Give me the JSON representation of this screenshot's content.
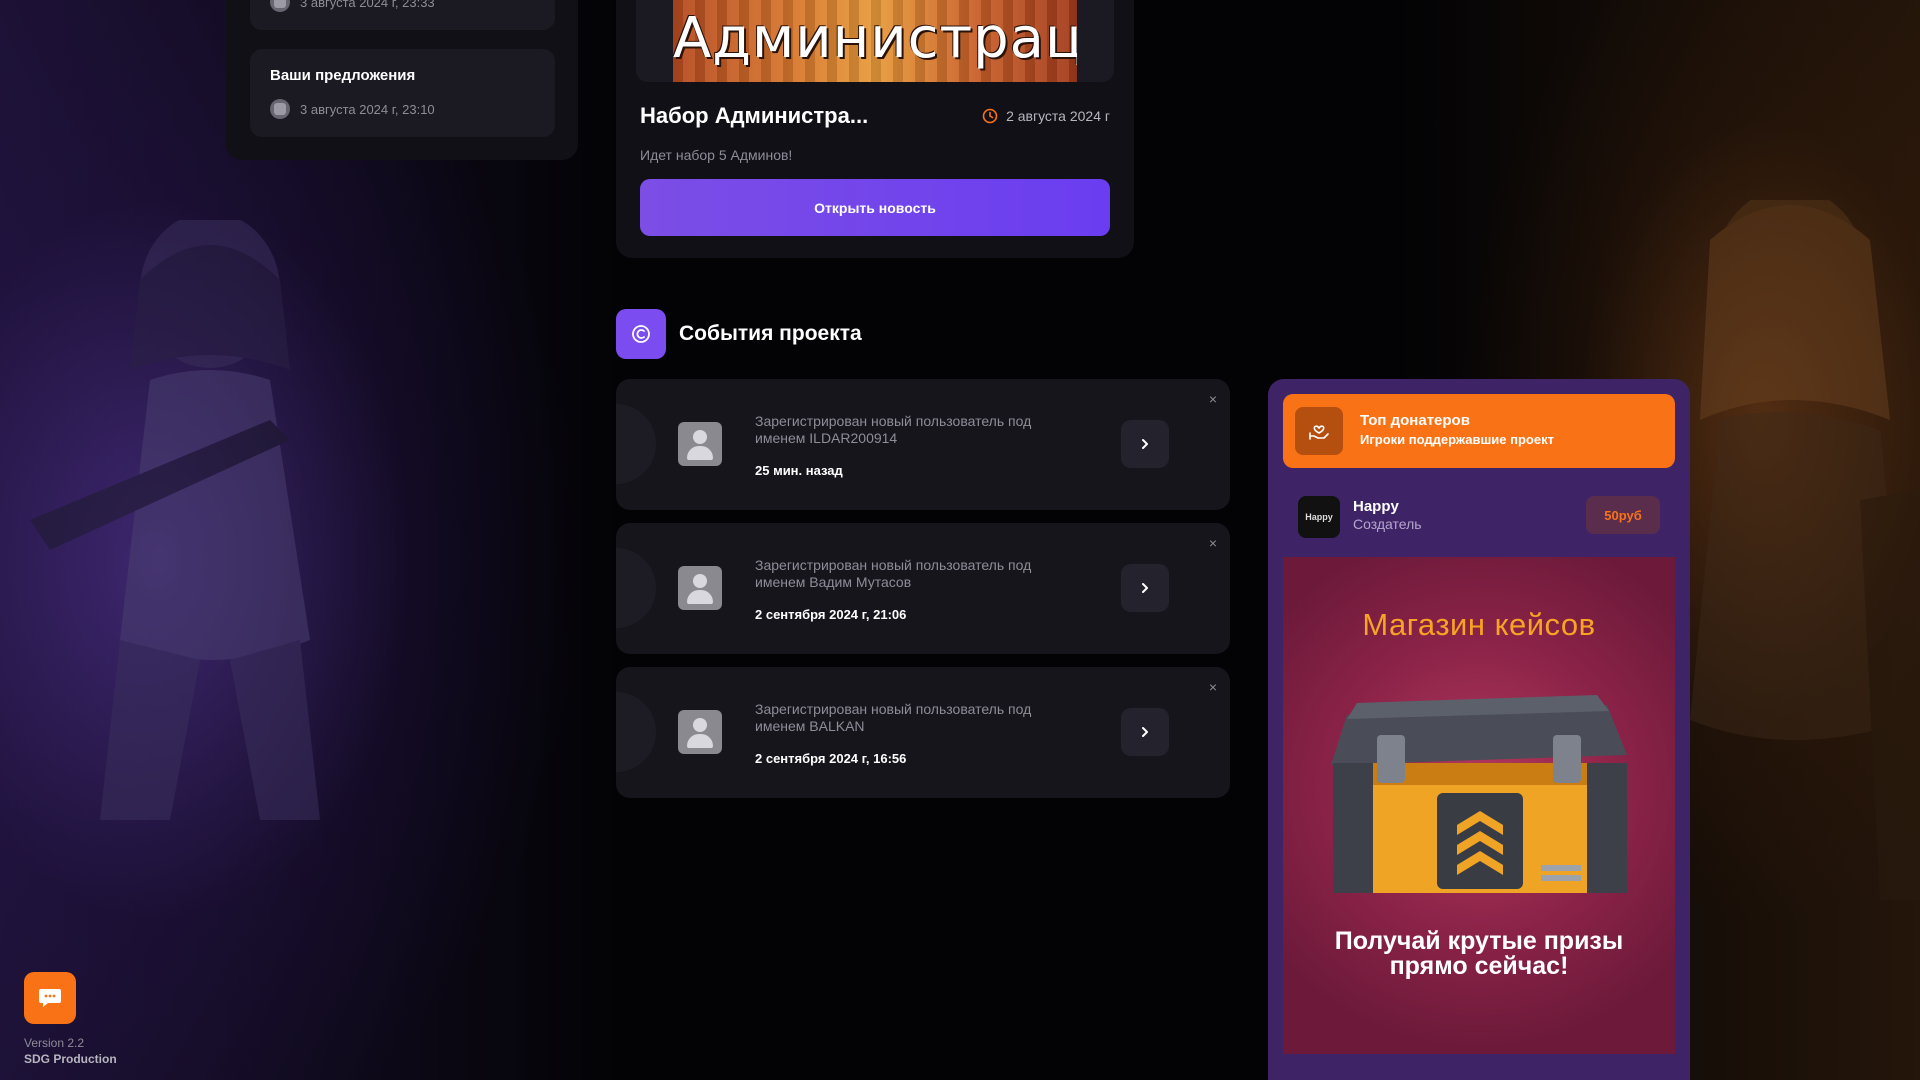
{
  "left_panel": {
    "notifications": [
      {
        "title": "",
        "date": "3 августа 2024 г, 23:33"
      },
      {
        "title": "Ваши предложения",
        "date": "3 августа 2024 г, 23:10"
      }
    ]
  },
  "news": {
    "image_text": "Администрацию",
    "title": "Набор Администра...",
    "date": "2 августа 2024 г",
    "description": "Идет набор 5 Админов!",
    "button_label": "Открыть новость"
  },
  "events": {
    "title": "События проекта",
    "items": [
      {
        "text": "Зарегистрирован новый пользователь под именем ILDAR200914",
        "time": "25 мин. назад",
        "close": "×"
      },
      {
        "text": "Зарегистрирован новый пользователь под именем Вадим Мутасов",
        "time": "2 сентября 2024 г, 21:06",
        "close": "×"
      },
      {
        "text": "Зарегистрирован новый пользователь под именем BALKAN",
        "time": "2 сентября 2024 г, 16:56",
        "close": "×"
      }
    ]
  },
  "donors": {
    "title": "Топ донатеров",
    "subtitle": "Игроки поддержавшие проект",
    "list": [
      {
        "avatar_text": "Happy",
        "name": "Happy",
        "role": "Создатель",
        "amount": "50руб"
      }
    ]
  },
  "shop": {
    "title": "Магазин кейсов",
    "subtitle_line1": "Получай крутые призы",
    "subtitle_line2": "прямо сейчас!"
  },
  "footer": {
    "version": "Version 2.2",
    "producer": "SDG Production"
  },
  "colors": {
    "accent_purple": "#7b4cf0",
    "accent_orange": "#f97316",
    "panel_dark": "#16151c",
    "sidebar_purple": "#3e2467"
  },
  "icons": [
    "clock-icon",
    "events-icon",
    "chevron-right-icon",
    "close-icon",
    "donor-hand-icon",
    "chat-icon",
    "user-placeholder-icon"
  ]
}
